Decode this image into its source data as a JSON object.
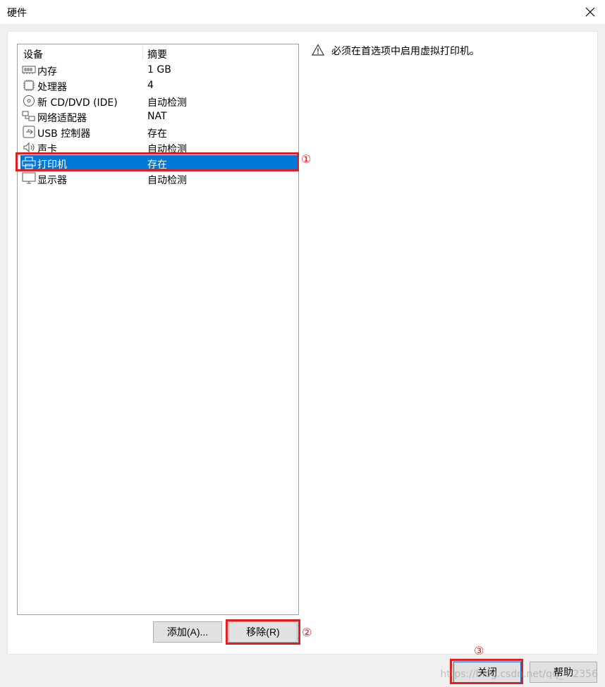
{
  "window": {
    "title": "硬件"
  },
  "device_list": {
    "columns": {
      "device": "设备",
      "summary": "摘要"
    },
    "rows": [
      {
        "icon": "memory-icon",
        "name": "内存",
        "summary": "1 GB",
        "selected": false
      },
      {
        "icon": "processor-icon",
        "name": "处理器",
        "summary": "4",
        "selected": false
      },
      {
        "icon": "cd-dvd-icon",
        "name": "新 CD/DVD (IDE)",
        "summary": "自动检测",
        "selected": false
      },
      {
        "icon": "network-adapter-icon",
        "name": "网络适配器",
        "summary": "NAT",
        "selected": false
      },
      {
        "icon": "usb-icon",
        "name": "USB 控制器",
        "summary": "存在",
        "selected": false
      },
      {
        "icon": "speaker-icon",
        "name": "声卡",
        "summary": "自动检测",
        "selected": false
      },
      {
        "icon": "printer-icon",
        "name": "打印机",
        "summary": "存在",
        "selected": true
      },
      {
        "icon": "monitor-icon",
        "name": "显示器",
        "summary": "自动检测",
        "selected": false
      }
    ]
  },
  "info": {
    "icon": "warning-icon",
    "message": "必须在首选项中启用虚拟打印机。"
  },
  "buttons": {
    "add": "添加(A)...",
    "remove": "移除(R)",
    "close": "关闭",
    "help": "帮助"
  },
  "annotations": {
    "marker_1": "①",
    "marker_2": "②",
    "marker_3": "③"
  },
  "watermark": {
    "text": "https://blog.csdn.net/qq_4 2356"
  },
  "colors": {
    "selection": "#0078d7",
    "annotation": "#e02020"
  }
}
